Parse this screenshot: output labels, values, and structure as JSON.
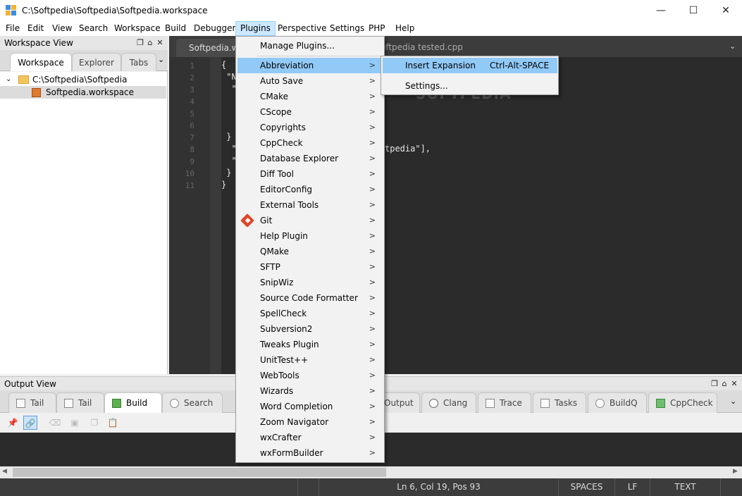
{
  "window": {
    "title": "C:\\Softpedia\\Softpedia\\Softpedia.workspace",
    "minimize": "—",
    "maximize": "☐",
    "close": "✕"
  },
  "menubar": [
    "File",
    "Edit",
    "View",
    "Search",
    "Workspace",
    "Build",
    "Debugger",
    "Plugins",
    "Perspective",
    "Settings",
    "PHP",
    "Help"
  ],
  "workspace": {
    "title": "Workspace View",
    "tabs": [
      "Workspace",
      "Explorer",
      "Tabs"
    ],
    "tree": {
      "folder": "C:\\Softpedia\\Softpedia",
      "file": "Softpedia.workspace"
    }
  },
  "editor": {
    "tab1": "Softpedia.wo",
    "tab2": "oftpedia tested.cpp",
    "watermark": "SOFTPEDIA",
    "line_numbers": [
      "1",
      "2",
      "3",
      "4",
      "5",
      "6",
      "7",
      "8",
      "9",
      "10",
      "11"
    ],
    "code": [
      "{",
      " \"N",
      "  \"",
      "",
      "",
      "",
      " }",
      "  \"",
      "  \"",
      " }",
      "}"
    ],
    "code_tail_line8": "tpedia\"],"
  },
  "plugins_menu": {
    "manage": "Manage Plugins...",
    "items": [
      "Abbreviation",
      "Auto Save",
      "CMake",
      "CScope",
      "Copyrights",
      "CppCheck",
      "Database Explorer",
      "Diff Tool",
      "EditorConfig",
      "External Tools",
      "Git",
      "Help Plugin",
      "QMake",
      "SFTP",
      "SnipWiz",
      "Source Code Formatter",
      "SpellCheck",
      "Subversion2",
      "Tweaks Plugin",
      "UnitTest++",
      "WebTools",
      "Wizards",
      "Word Completion",
      "Zoom Navigator",
      "wxCrafter",
      "wxFormBuilder"
    ],
    "arrow": ">"
  },
  "abbreviation_menu": {
    "insert": "Insert Expansion",
    "shortcut": "Ctrl-Alt-SPACE",
    "settings": "Settings..."
  },
  "output": {
    "title": "Output View",
    "tabs": [
      "Tail",
      "Tail",
      "Build",
      "Search",
      "Output",
      "Clang",
      "Trace",
      "Tasks",
      "BuildQ",
      "CppCheck"
    ]
  },
  "status": {
    "position": "Ln 6, Col 19, Pos 93",
    "indent": "SPACES",
    "eol": "LF",
    "mode": "TEXT"
  },
  "colors": {
    "menu_highlight": "#91c9f7",
    "editor_bg": "#2b2b2b",
    "status_bg": "#3c3c3c"
  }
}
